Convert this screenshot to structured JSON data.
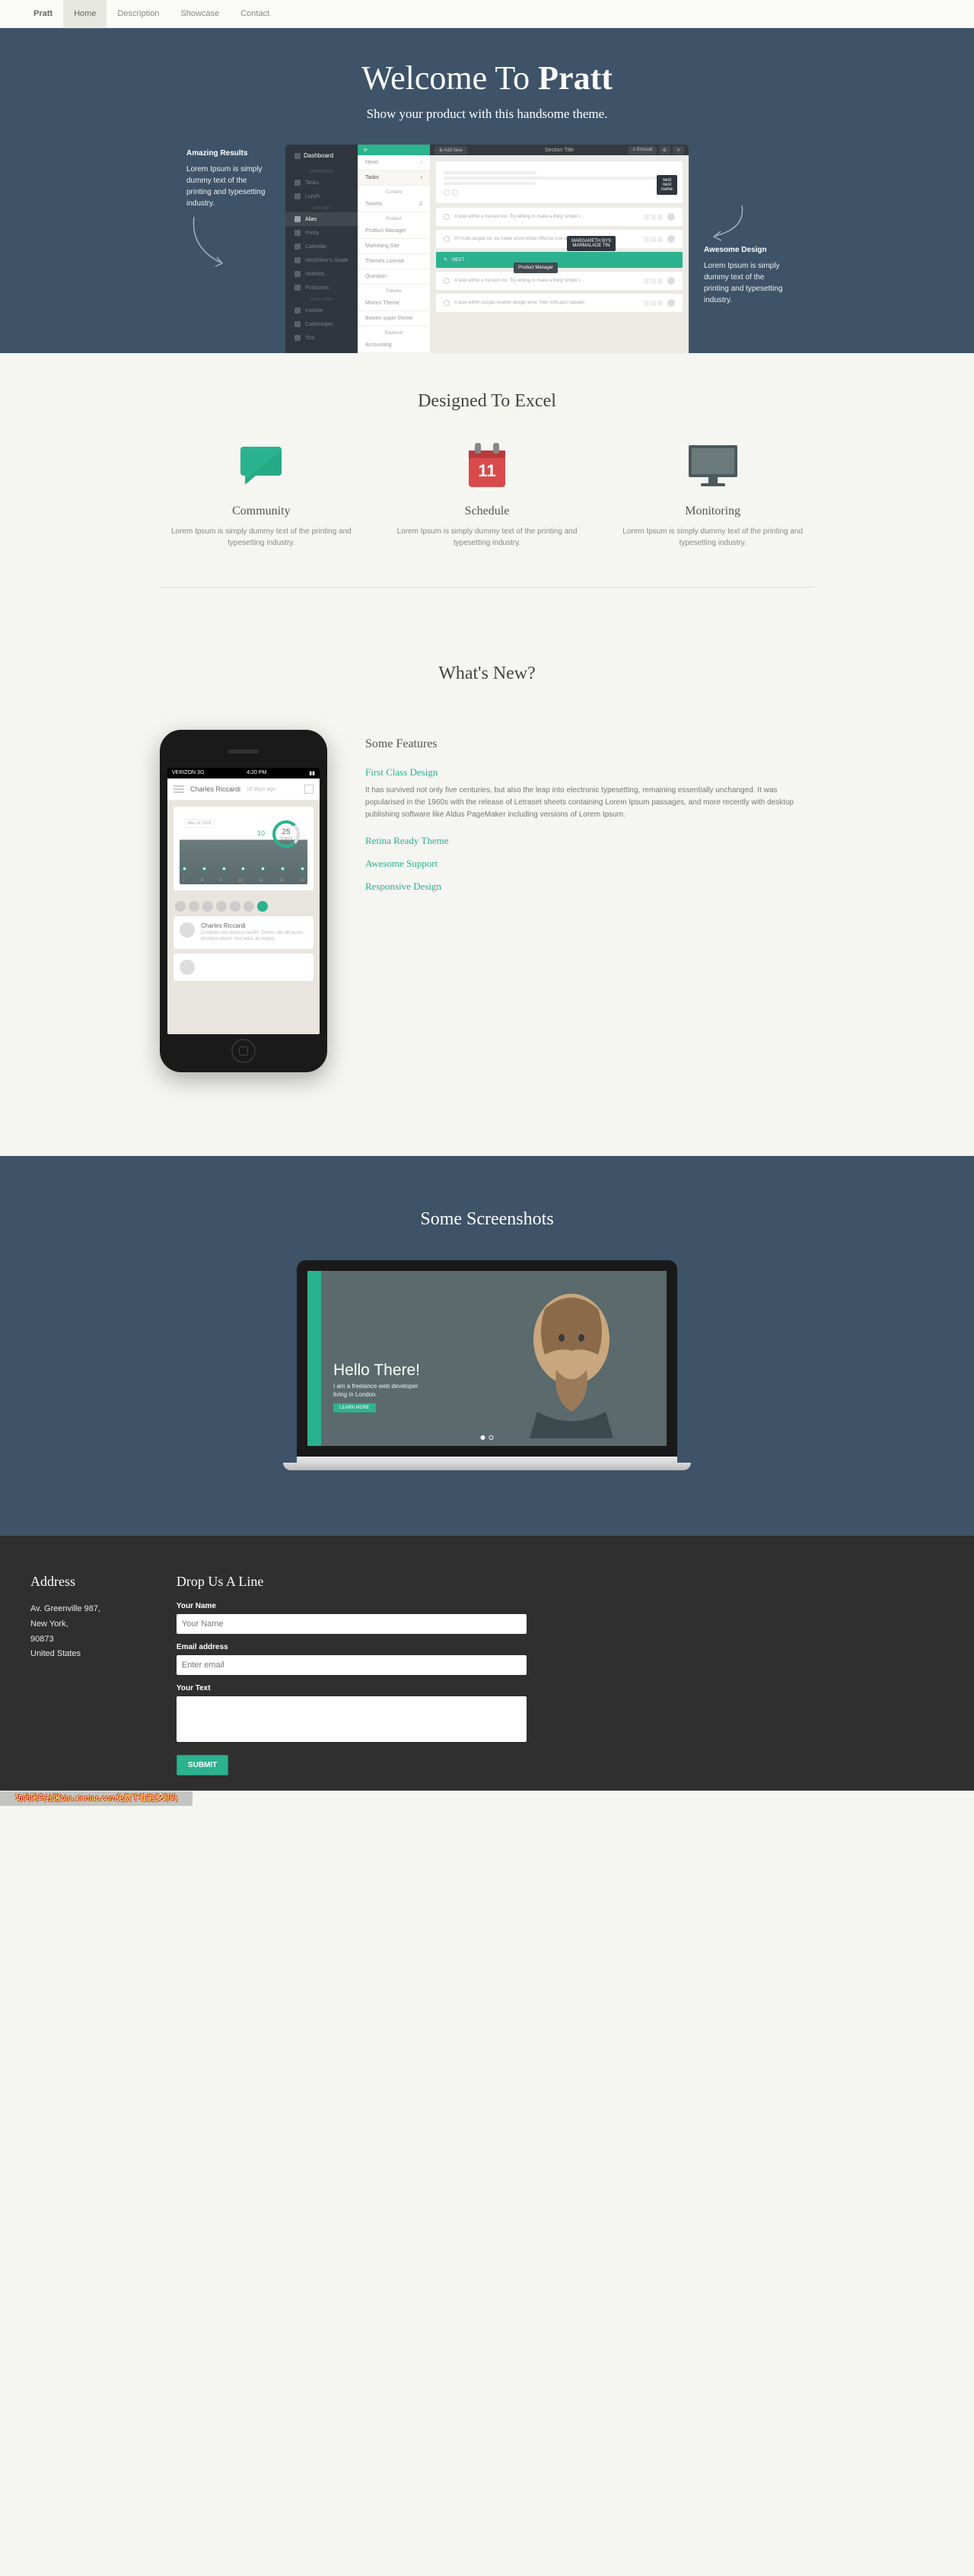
{
  "nav": {
    "brand": "Pratt",
    "items": [
      "Home",
      "Description",
      "Showcase",
      "Contact"
    ],
    "active_index": 0
  },
  "hero": {
    "title_pre": "Welcome To ",
    "title_bold": "Pratt",
    "subtitle": "Show your product with this handsome theme.",
    "left": {
      "heading": "Amazing Results",
      "text": "Lorem Ipsum is simply dummy text of the printing and typesetting industry."
    },
    "right": {
      "heading": "Awesome Design",
      "text": "Lorem Ipsum is simply dummy text of the printing and typesetting industry."
    }
  },
  "app": {
    "brand": "Dashboard",
    "sidebar_sections": [
      {
        "label": "FAVOURITES",
        "items": [
          "Tasks",
          "Lunch"
        ]
      },
      {
        "label": "CONTENT",
        "items": [
          "Alias",
          "Pretty",
          "Calendar",
          "Hitchhiker's Guide",
          "Notelets",
          "Postcards"
        ]
      },
      {
        "label": "PLUG SHOP",
        "items": [
          "Invision",
          "Carbonopro",
          "Tice"
        ]
      }
    ],
    "mid": {
      "tabs": [
        "News",
        "Tasks"
      ],
      "heads": [
        "Content",
        "Product",
        "Themes",
        "Backend"
      ],
      "items": {
        "content": [
          "Tweets"
        ],
        "product": [
          "Product Manager",
          "Marketing Site",
          "Themes License",
          "Question"
        ],
        "themes": [
          "Moneo Theme",
          "Bowen super theme"
        ],
        "backend": [
          "Accounting"
        ]
      }
    },
    "main": {
      "title": "Section Title",
      "add": "⊕ Add New",
      "showall": "≡ Showall",
      "tooltips": {
        "t1": "nest\nnest\nname",
        "t2": "MARGARETH BYS\nMARMALADE TIN",
        "t3": "Product Manager"
      },
      "rows": [
        "A task within a mission list. Try writing to make a thing simple t...",
        "Pri nulla laugiat no, ea natae unum elitae offensa vi te laudamusne",
        "A task within a mission list. Try writing to make a thing simple t...",
        "A task within cozyas reseller design amiv. Sein mihi apis nadales"
      ]
    }
  },
  "designed": {
    "heading": "Designed To Excel",
    "features": [
      {
        "title": "Community",
        "desc": "Lorem Ipsum is simply dummy text of the printing and typesetting industry.",
        "day": ""
      },
      {
        "title": "Schedule",
        "desc": "Lorem Ipsum is simply dummy text of the printing and typesetting industry.",
        "day": "11"
      },
      {
        "title": "Monitoring",
        "desc": "Lorem Ipsum is simply dummy text of the printing and typesetting industry.",
        "day": ""
      }
    ]
  },
  "whatsnew": {
    "heading": "What's New?",
    "phone": {
      "carrier": "VERIZON 3G",
      "time": "4:20 PM",
      "user": "Charles Riccardi",
      "ago": "15 days ago",
      "date_badge": "May 13, 2013",
      "count": "10",
      "donut": {
        "value": "25",
        "label": "Visitors"
      },
      "days": [
        "7",
        "8",
        "9",
        "10",
        "11",
        "12",
        "13"
      ],
      "item_name": "Charles Riccardi",
      "item_desc": "Curabitur otoi leoreus ceclith. Donec nibi olit purus, tincidunt sitend. Sed tellus at magna."
    },
    "features_title": "Some Features",
    "items": [
      {
        "title": "First Class Design",
        "body": "It has survived not only five centuries, but also the leap into electronic typesetting, remaining essentially unchanged. It was popularised in the 1960s with the release of Letraset sheets containing Lorem Ipsum passages, and more recently with desktop publishing software like Aldus PageMaker including versions of Lorem Ipsum."
      },
      {
        "title": "Retina Ready Theme",
        "body": ""
      },
      {
        "title": "Awesome Support",
        "body": ""
      },
      {
        "title": "Responsive Design",
        "body": ""
      }
    ]
  },
  "screenshots": {
    "heading": "Some Screenshots",
    "hello": "Hello There!",
    "tagline": "I am a freelance web developer\nliving in London.",
    "button": "LEARN MORE"
  },
  "footer": {
    "address_title": "Address",
    "address_lines": [
      "Av. Greenville 987,",
      "New York,",
      "90873",
      "United States"
    ],
    "form_title": "Drop Us A Line",
    "labels": {
      "name": "Your Name",
      "email": "Email address",
      "text": "Your Text"
    },
    "placeholders": {
      "name": "Your Name",
      "email": "Enter email"
    },
    "submit": "SUBMIT"
  },
  "watermark": "访问闲鸟社区bbs.xienIao.com免费下载更多源码"
}
